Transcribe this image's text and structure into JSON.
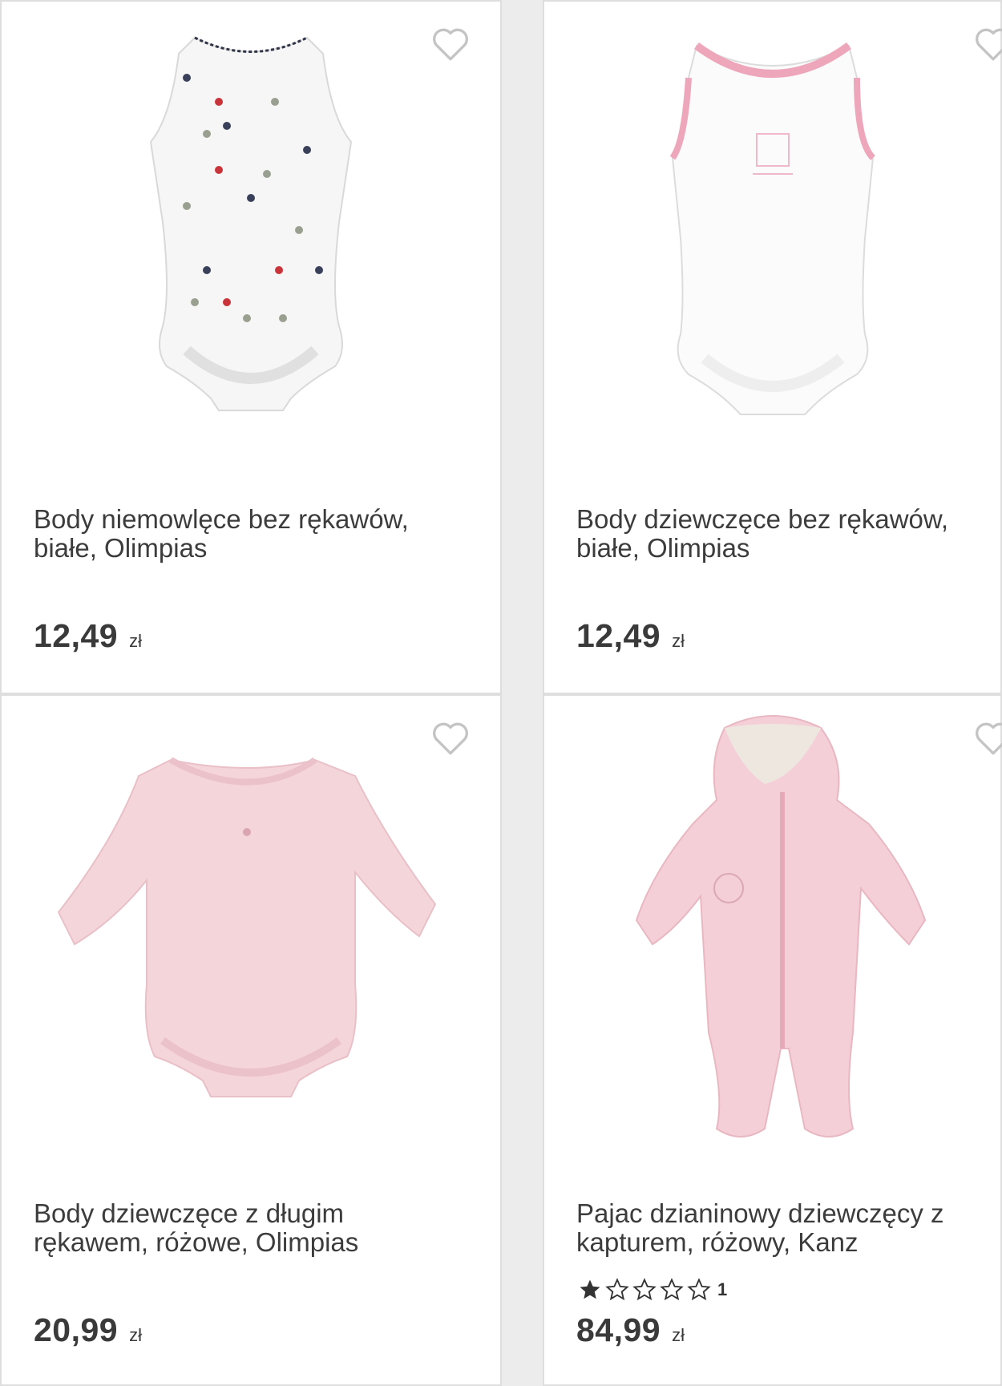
{
  "products": [
    {
      "name": "Body niemowlęce bez rękawów, białe, Olimpias",
      "price": "12,49",
      "currency": "zł",
      "image": "sleeveless-bodysuit-white-print",
      "favorite_icon": "heart-outline-icon"
    },
    {
      "name": "Body dziewczęce bez rękawów, białe, Olimpias",
      "price": "12,49",
      "currency": "zł",
      "image": "sleeveless-bodysuit-white-pink-trim",
      "favorite_icon": "heart-outline-icon"
    },
    {
      "name": "Body dziewczęce z długim rękawem, różowe, Olimpias",
      "price": "20,99",
      "currency": "zł",
      "image": "long-sleeve-bodysuit-pink",
      "favorite_icon": "heart-outline-icon"
    },
    {
      "name": "Pajac dzianinowy dziewczęcy z kapturem, różowy, Kanz",
      "price": "84,99",
      "currency": "zł",
      "image": "hooded-romper-pink",
      "favorite_icon": "heart-outline-icon",
      "rating": {
        "value": 1,
        "max": 5,
        "count": "1"
      }
    }
  ],
  "colors": {
    "text": "#3a3a3a",
    "border": "#dedede",
    "heart": "#c4c4c4",
    "pink": "#f2cfd6",
    "star": "#333333"
  }
}
